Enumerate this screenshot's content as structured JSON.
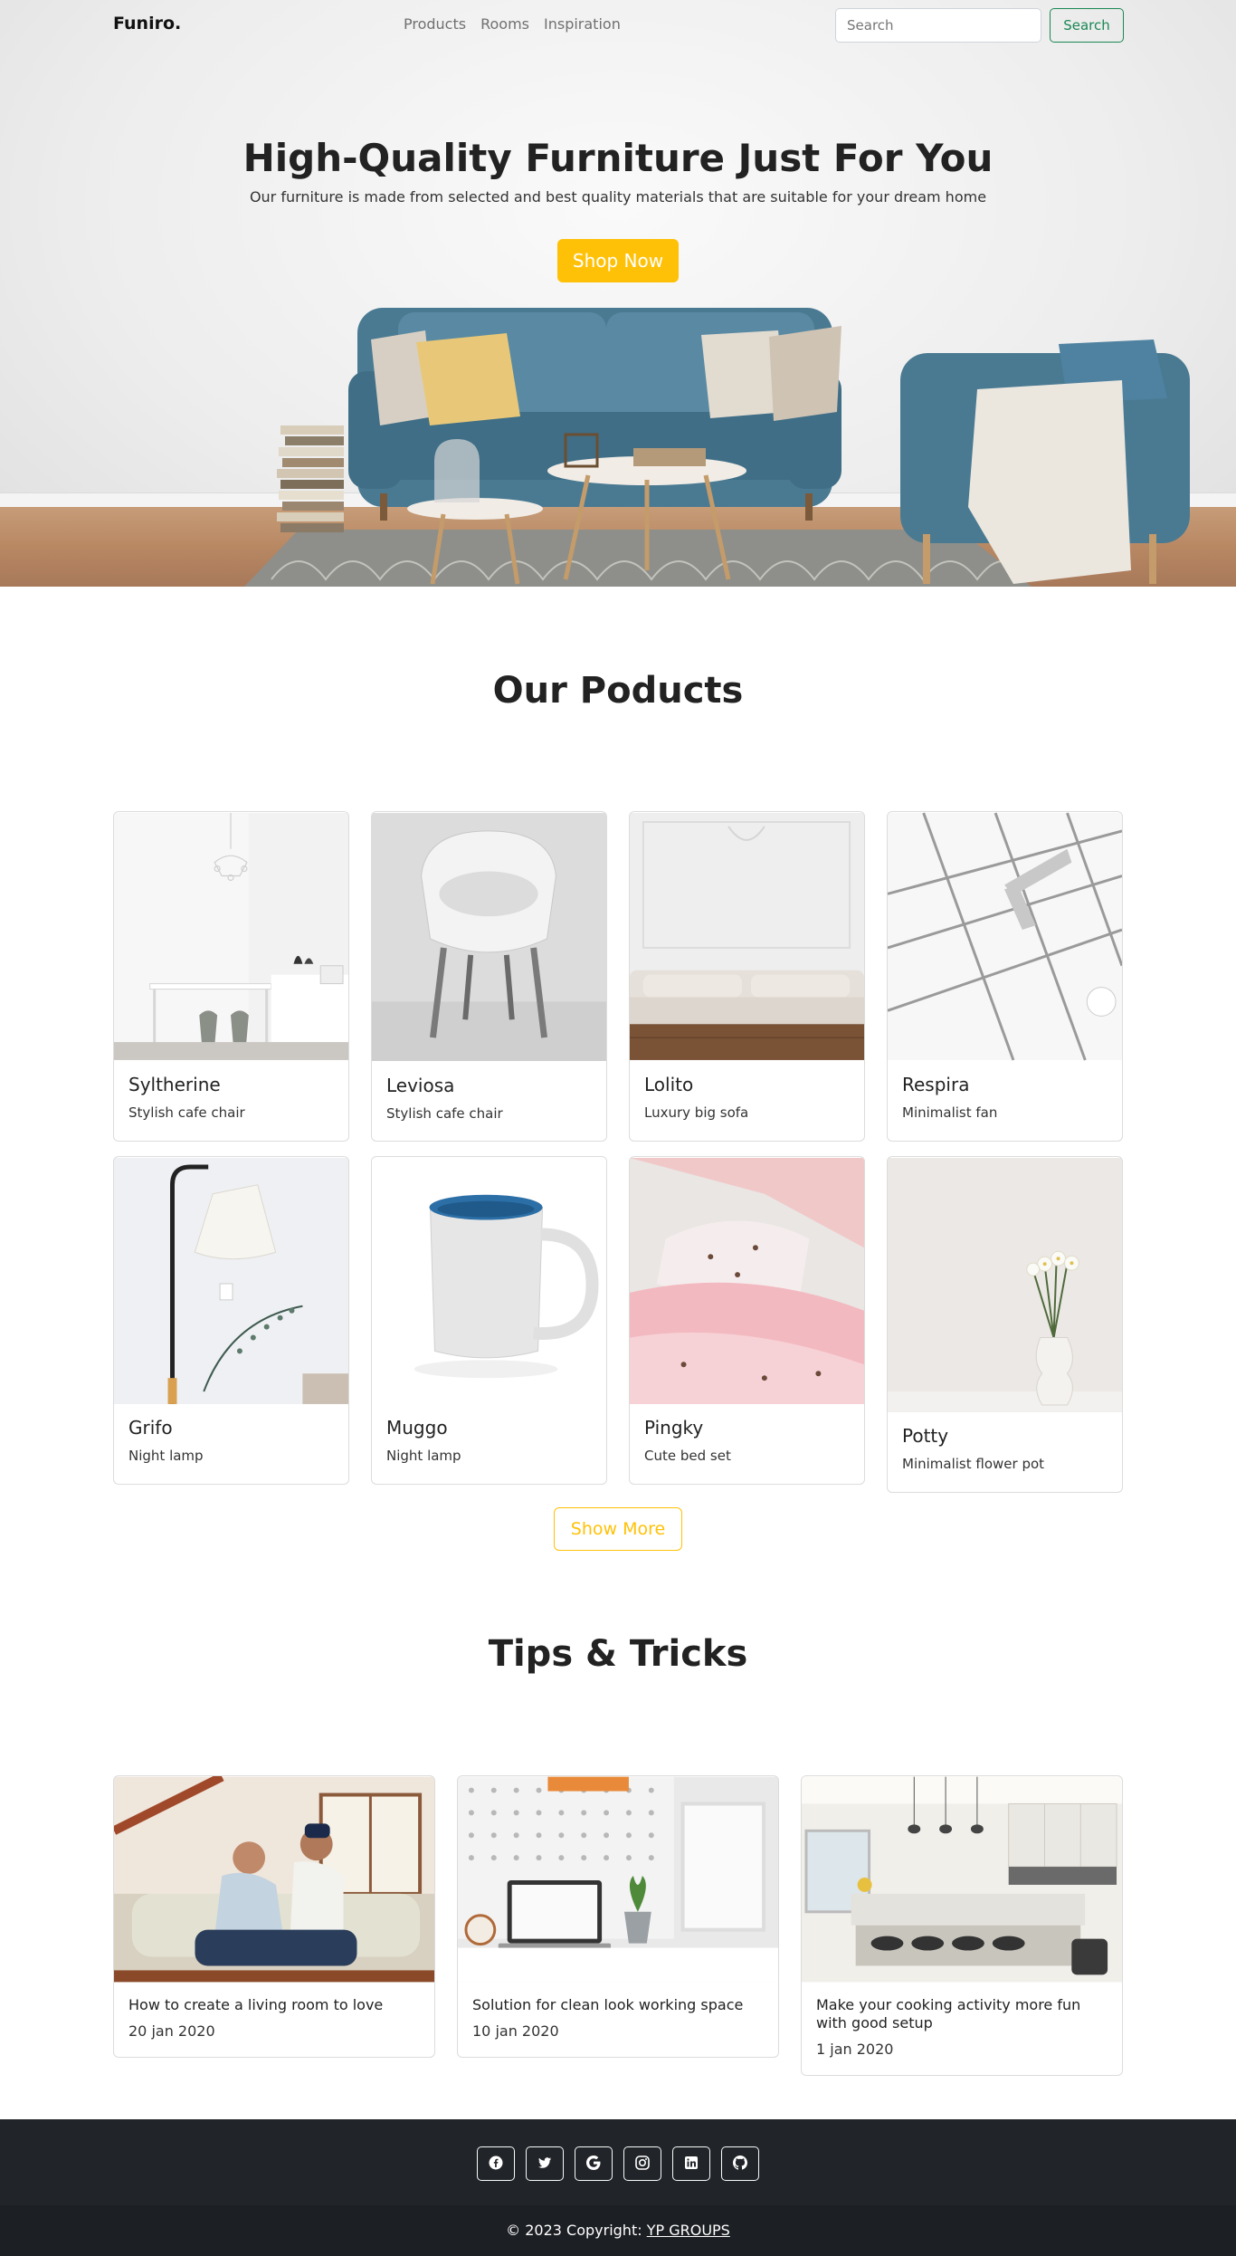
{
  "navbar": {
    "brand": "Funiro.",
    "links": [
      "Products",
      "Rooms",
      "Inspiration"
    ],
    "search_placeholder": "Search",
    "search_button": "Search"
  },
  "hero": {
    "title": "High-Quality Furniture Just For You",
    "subtitle": "Our furniture is made from selected and best quality materials that are suitable for your dream home",
    "cta": "Shop Now"
  },
  "products": {
    "title": "Our Poducts",
    "items": [
      {
        "name": "Syltherine",
        "desc": "Stylish cafe chair"
      },
      {
        "name": "Leviosa",
        "desc": "Stylish cafe chair"
      },
      {
        "name": "Lolito",
        "desc": "Luxury big sofa"
      },
      {
        "name": "Respira",
        "desc": "Minimalist fan"
      },
      {
        "name": "Grifo",
        "desc": "Night lamp"
      },
      {
        "name": "Muggo",
        "desc": "Night lamp"
      },
      {
        "name": "Pingky",
        "desc": "Cute bed set"
      },
      {
        "name": "Potty",
        "desc": "Minimalist flower pot"
      }
    ],
    "show_more": "Show More"
  },
  "tips": {
    "title": "Tips & Tricks",
    "items": [
      {
        "title": "How to create a living room to love",
        "date": "20 jan 2020"
      },
      {
        "title": "Solution for clean look working space",
        "date": "10 jan 2020"
      },
      {
        "title": "Make your cooking activity more fun with good setup",
        "date": "1 jan 2020"
      }
    ]
  },
  "footer": {
    "social_icons": [
      "facebook-icon",
      "twitter-icon",
      "google-icon",
      "instagram-icon",
      "linkedin-icon",
      "github-icon"
    ],
    "copyright": "© 2023 Copyright:",
    "company": "YP GROUPS"
  },
  "colors": {
    "accent": "#ffc107",
    "success": "#198754",
    "footer": "#212529"
  }
}
